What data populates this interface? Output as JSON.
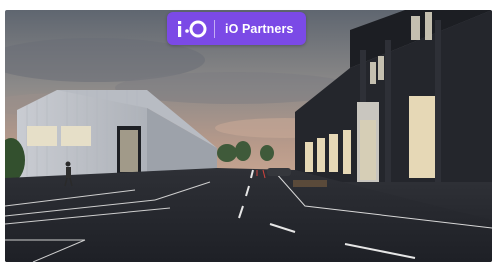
{
  "badge": {
    "logo_icon": "io-logo-icon",
    "label": "iO Partners",
    "background": "#7b4ae6"
  },
  "carousel": {
    "next_icon": "chevron-right-icon"
  },
  "photo": {
    "subject": "industrial-estate-street-render"
  }
}
